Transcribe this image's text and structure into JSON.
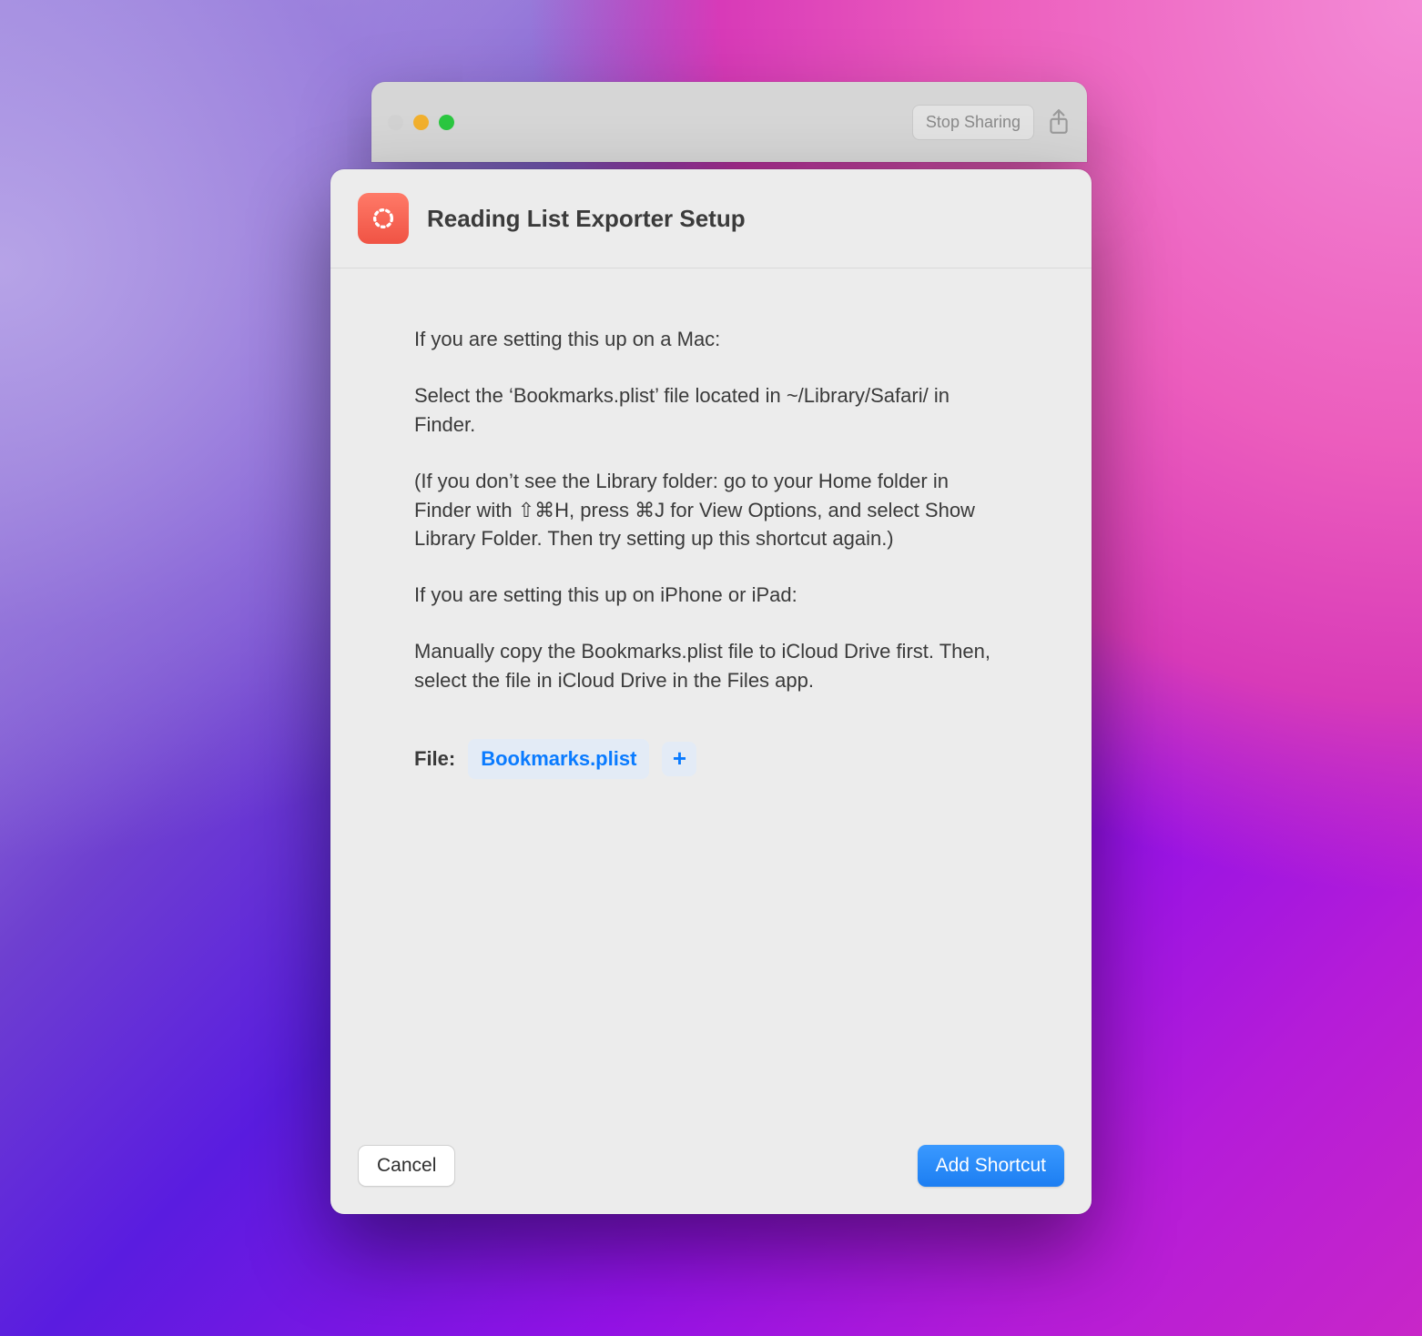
{
  "parent_window": {
    "stop_sharing_label": "Stop Sharing"
  },
  "sheet": {
    "title": "Reading List Exporter Setup",
    "body": {
      "p1": "If you are setting this up on a Mac:",
      "p2": "Select the ‘Bookmarks.plist’ file located in ~/Library/Safari/ in Finder.",
      "p3": "(If you don’t see the Library folder: go to your Home folder in Finder with ⇧⌘H, press ⌘J for View Options, and select Show Library Folder. Then try setting up this shortcut again.)",
      "p4": "If you are setting this up on iPhone or iPad:",
      "p5": "Manually copy the Bookmarks.plist file to iCloud Drive first. Then, select the file in iCloud Drive in the Files app."
    },
    "file": {
      "label": "File:",
      "chip": "Bookmarks.plist",
      "plus_symbol": "+"
    },
    "buttons": {
      "cancel": "Cancel",
      "add": "Add Shortcut"
    }
  }
}
